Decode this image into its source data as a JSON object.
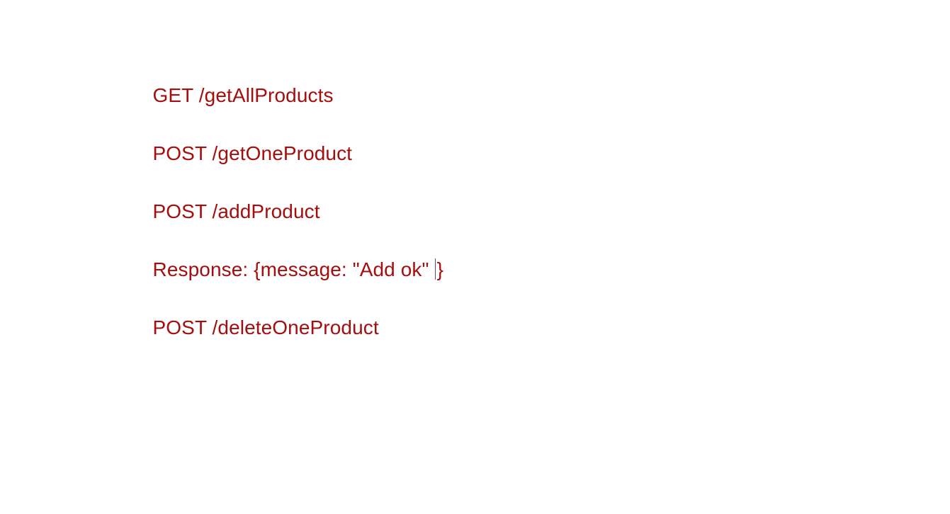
{
  "theme": {
    "text_color": "#a50e0e",
    "background": "#ffffff"
  },
  "document": {
    "lines": [
      {
        "text": "GET /getAllProducts"
      },
      {
        "text": "POST /getOneProduct"
      },
      {
        "text": "POST /addProduct"
      },
      {
        "text_before_caret": "Response: {message: \"Add ok\" ",
        "text_after_caret": "}"
      },
      {
        "text": "POST /deleteOneProduct"
      }
    ]
  }
}
